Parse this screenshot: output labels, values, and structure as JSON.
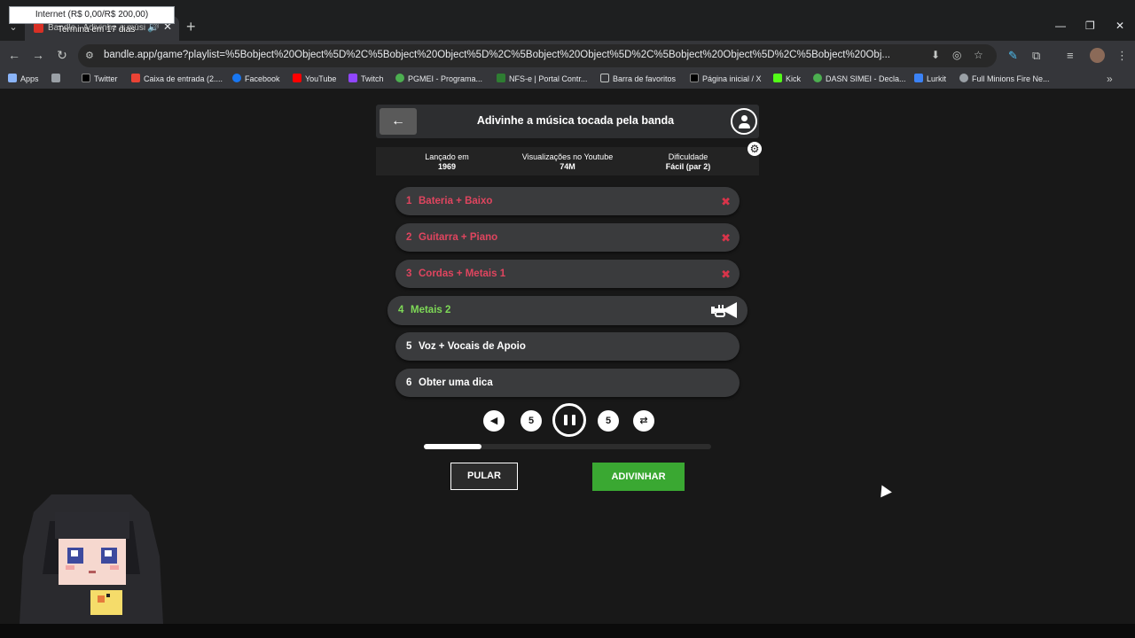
{
  "browser": {
    "hover_card": "Internet (R$ 0,00/R$ 200,00)",
    "tab": {
      "title": "Bandle - Adivinhe a música",
      "tooltip": "Termina em 17 dias"
    },
    "url": "bandle.app/game?playlist=%5Bobject%20Object%5D%2C%5Bobject%20Object%5D%2C%5Bobject%20Object%5D%2C%5Bobject%20Object%5D%2C%5Bobject%20Obj...",
    "bookmarks": [
      {
        "label": "Apps",
        "color": "#8ab4f8"
      },
      {
        "label": "",
        "color": "#9aa0a6"
      },
      {
        "label": "Twitter",
        "color": "#000000"
      },
      {
        "label": "Caixa de entrada (2....",
        "color": "#ea4335"
      },
      {
        "label": "Facebook",
        "color": "#1877f2"
      },
      {
        "label": "YouTube",
        "color": "#ff0000"
      },
      {
        "label": "Twitch",
        "color": "#9146ff"
      },
      {
        "label": "PGMEI - Programa...",
        "color": "#4caf50"
      },
      {
        "label": "NFS-e | Portal Contr...",
        "color": "#2e7d32"
      },
      {
        "label": "Barra de favoritos",
        "color": "#9aa0a6"
      },
      {
        "label": "Página inicial / X",
        "color": "#000000"
      },
      {
        "label": "Kick",
        "color": "#53fc18"
      },
      {
        "label": "DASN SIMEI - Decla...",
        "color": "#4caf50"
      },
      {
        "label": "Lurkit",
        "color": "#3b82f6"
      },
      {
        "label": "Full Minions Fire Ne...",
        "color": "#9aa0a6"
      }
    ]
  },
  "game": {
    "title": "Adivinhe a música tocada pela banda",
    "info": [
      {
        "label": "Lançado em",
        "value": "1969"
      },
      {
        "label": "Visualizações no Youtube",
        "value": "74M"
      },
      {
        "label": "Dificuldade",
        "value": "Fácil (par 2)"
      }
    ],
    "rounds": [
      {
        "num": "1",
        "label": "Bateria + Baixo",
        "status": "failed",
        "mark": "✖"
      },
      {
        "num": "2",
        "label": "Guitarra + Piano",
        "status": "failed",
        "mark": "✖"
      },
      {
        "num": "3",
        "label": "Cordas + Metais 1",
        "status": "failed",
        "mark": "✖"
      },
      {
        "num": "4",
        "label": "Metais 2",
        "status": "current",
        "icon": "trumpet-icon"
      },
      {
        "num": "5",
        "label": "Voz + Vocais de Apoio",
        "status": "pending"
      },
      {
        "num": "6",
        "label": "Obter uma dica",
        "status": "pending"
      }
    ],
    "controls": {
      "rewind_label": "5",
      "forward_label": "5"
    },
    "progress": 0.2,
    "buttons": {
      "skip": "PULAR",
      "guess": "ADIVINHAR"
    },
    "colors": {
      "failed": "#e0455f",
      "current": "#7ed957",
      "guess_button": "#3aa832"
    }
  }
}
